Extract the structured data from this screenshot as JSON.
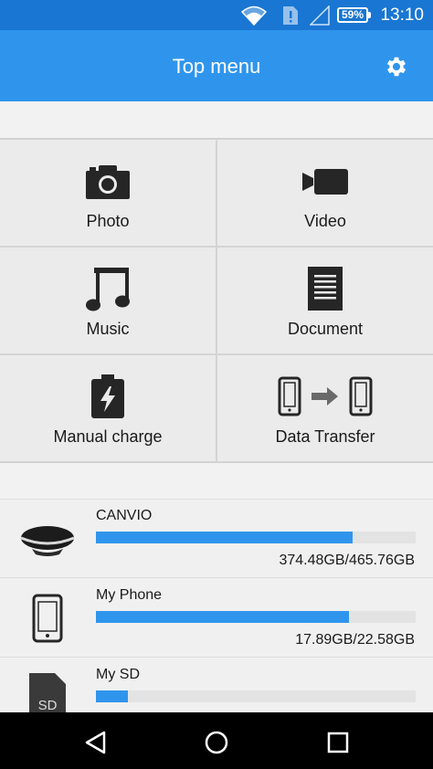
{
  "status_bar": {
    "battery": "59%",
    "time": "13:10",
    "icons": [
      "wifi-icon",
      "sim-alert-icon",
      "signal-icon",
      "battery-icon"
    ]
  },
  "app_bar": {
    "title": "Top menu",
    "settings_icon": "gear-icon"
  },
  "menu": {
    "tiles": [
      {
        "label": "Photo",
        "icon": "camera-icon"
      },
      {
        "label": "Video",
        "icon": "video-camera-icon"
      },
      {
        "label": "Music",
        "icon": "music-note-icon"
      },
      {
        "label": "Document",
        "icon": "document-icon"
      },
      {
        "label": "Manual charge",
        "icon": "battery-charge-icon"
      },
      {
        "label": "Data Transfer",
        "icon": "phone-transfer-icon"
      }
    ]
  },
  "storage": {
    "devices": [
      {
        "name": "CANVIO",
        "usage": "374.48GB/465.76GB",
        "used_fraction": 0.804,
        "icon": "external-drive-icon"
      },
      {
        "name": "My Phone",
        "usage": "17.89GB/22.58GB",
        "used_fraction": 0.792,
        "icon": "phone-icon"
      },
      {
        "name": "My SD",
        "usage": "",
        "used_fraction": 0.1,
        "icon": "sd-card-icon",
        "sd_label": "SD"
      }
    ]
  },
  "colors": {
    "status_bar": "#1976d2",
    "app_bar": "#2f95ec",
    "progress": "#2f95ec"
  }
}
